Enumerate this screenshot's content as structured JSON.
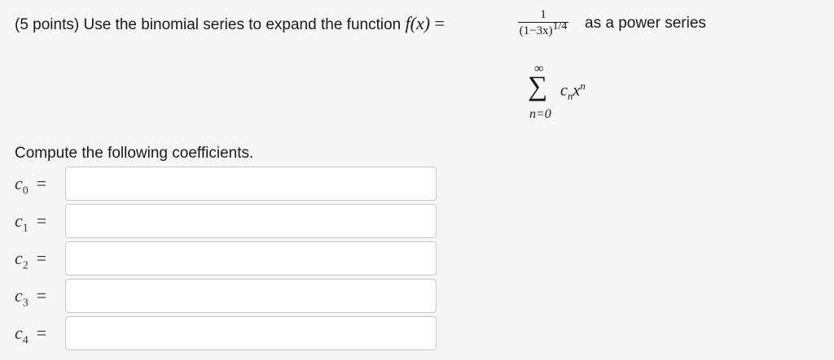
{
  "question": {
    "prefix": "(5 points) Use the binomial series to expand the function ",
    "func": "f(x)",
    "equals": " = ",
    "frac_num": "1",
    "frac_den": "(1−3x)",
    "frac_exp": "1/4",
    "suffix": "as a power series"
  },
  "series": {
    "upper": "∞",
    "sigma": "∑",
    "lower": "n=0",
    "coef": "c",
    "coef_sub": "n",
    "var": "x",
    "var_sup": "n"
  },
  "prompt": "Compute the following coefficients.",
  "fields": [
    {
      "var": "c",
      "index": "0",
      "eq": "=",
      "value": ""
    },
    {
      "var": "c",
      "index": "1",
      "eq": "=",
      "value": ""
    },
    {
      "var": "c",
      "index": "2",
      "eq": "=",
      "value": ""
    },
    {
      "var": "c",
      "index": "3",
      "eq": "=",
      "value": ""
    },
    {
      "var": "c",
      "index": "4",
      "eq": "=",
      "value": ""
    }
  ]
}
